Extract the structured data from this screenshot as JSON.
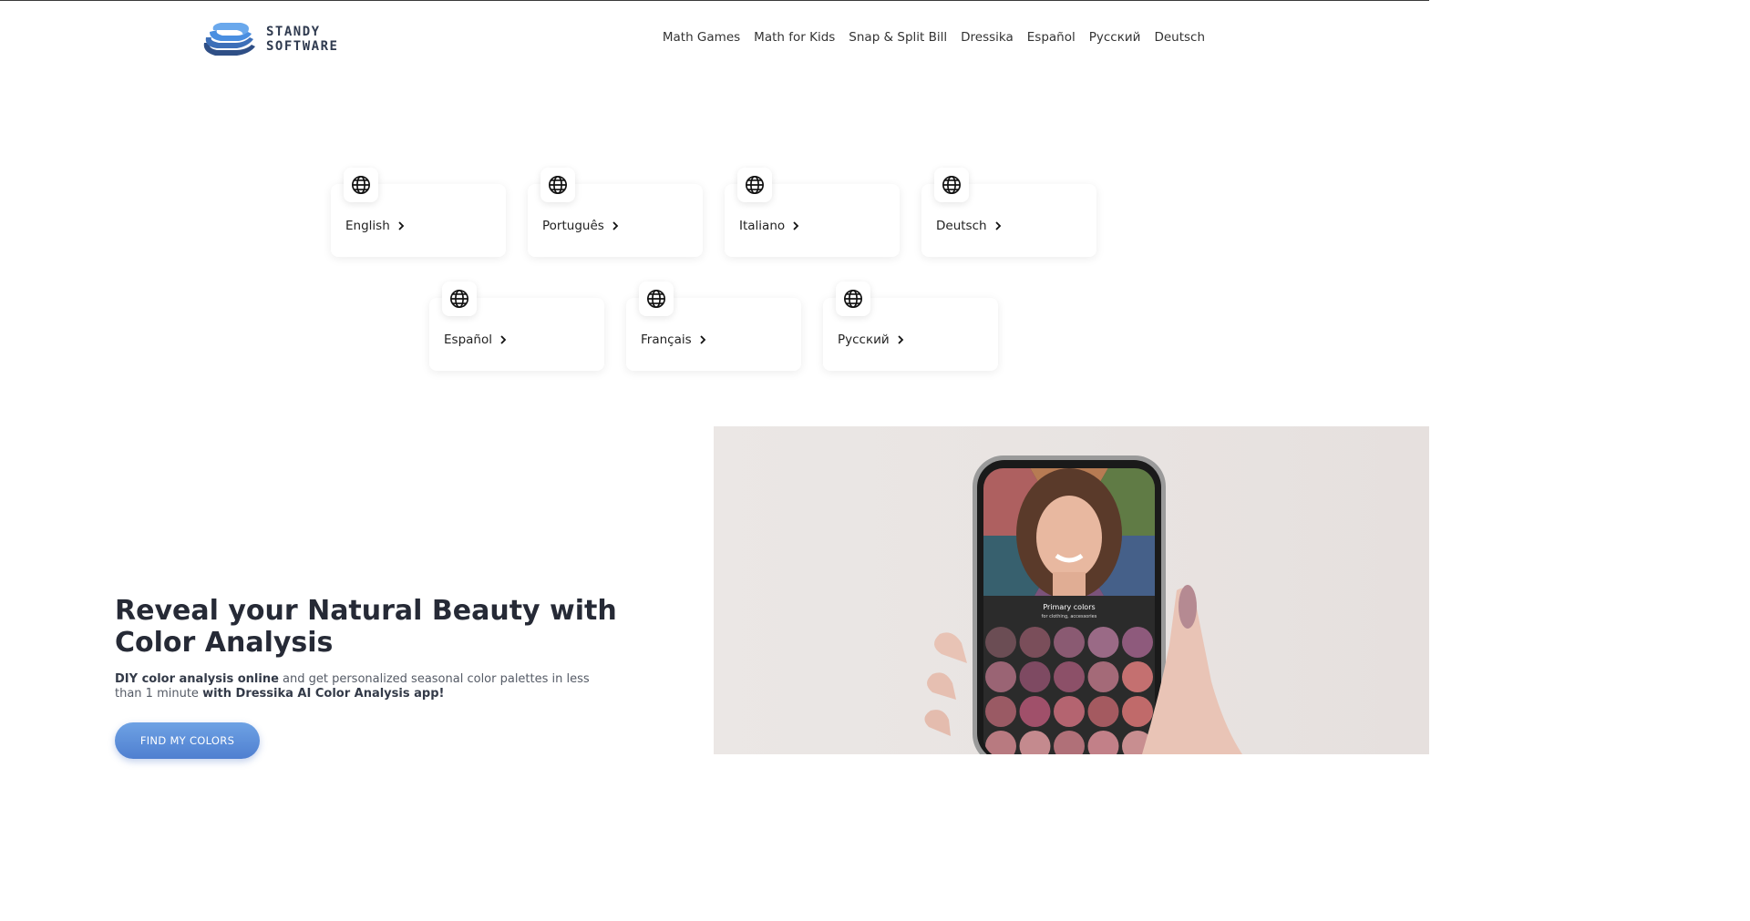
{
  "header": {
    "logo_line1": "STANDY",
    "logo_line2": "SOFTWARE",
    "nav": [
      "Math Games",
      "Math for Kids",
      "Snap & Split Bill",
      "Dressika",
      "Español",
      "Русский",
      "Deutsch"
    ]
  },
  "languages": [
    "English",
    "Português",
    "Italiano",
    "Deutsch",
    "Español",
    "Français",
    "Русский"
  ],
  "hero": {
    "title": "Reveal your Natural Beauty with Color Analysis",
    "subtitle_bold1": "DIY color analysis online",
    "subtitle_text": " and get personalized seasonal color palettes in less than 1 minute ",
    "subtitle_bold2": "with Dressika AI Color Analysis app!",
    "cta": "FIND MY COLORS"
  },
  "phone": {
    "panel_title": "Primary colors",
    "panel_subtitle": "for clothing, accessories",
    "swatches": [
      "#6b4d54",
      "#7a4e5a",
      "#8a5a72",
      "#9a6a86",
      "#8e5a7c",
      "#9a6474",
      "#7e4a62",
      "#8c5068",
      "#a46a78",
      "#c47070",
      "#9a5a64",
      "#a0506a",
      "#b46470",
      "#a45a60",
      "#c06a6a",
      "#b87a80",
      "#c48a8e",
      "#b07078",
      "#c28088",
      "#c88e90"
    ],
    "fan_colors": [
      "#c56a6a",
      "#d08a5a",
      "#6a8a4a",
      "#4a6a9a",
      "#8a5a8a",
      "#3a6a7a"
    ]
  },
  "colors": {
    "accent": "#5a8ada",
    "text_dark": "#262a36",
    "logo_blue": "#4a8ee0"
  }
}
